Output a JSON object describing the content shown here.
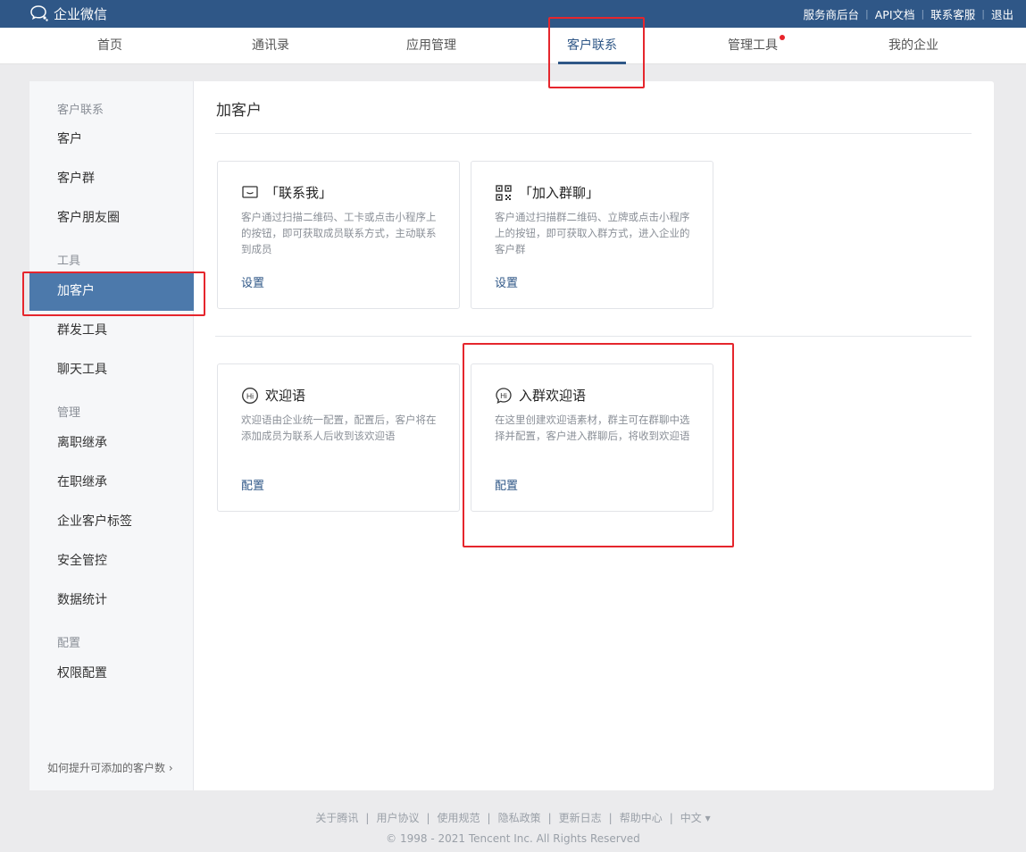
{
  "brand": {
    "name": "企业微信",
    "logo_icon": "wecom-logo-icon"
  },
  "top_links": [
    {
      "label": "服务商后台"
    },
    {
      "label": "API文档"
    },
    {
      "label": "联系客服"
    },
    {
      "label": "退出"
    }
  ],
  "nav": {
    "items": [
      {
        "label": "首页"
      },
      {
        "label": "通讯录"
      },
      {
        "label": "应用管理"
      },
      {
        "label": "客户联系",
        "active": true
      },
      {
        "label": "管理工具",
        "badge": "red-dot"
      },
      {
        "label": "我的企业"
      }
    ]
  },
  "sidebar": {
    "groups": [
      {
        "title": "客户联系",
        "items": [
          "客户",
          "客户群",
          "客户朋友圈"
        ]
      },
      {
        "title": "工具",
        "items": [
          "加客户",
          "群发工具",
          "聊天工具"
        ]
      },
      {
        "title": "管理",
        "items": [
          "离职继承",
          "在职继承",
          "企业客户标签",
          "安全管控",
          "数据统计"
        ]
      },
      {
        "title": "配置",
        "items": [
          "权限配置"
        ]
      }
    ],
    "active_item": "加客户",
    "footer_link": "如何提升可添加的客户数"
  },
  "main": {
    "title": "加客户",
    "cards": [
      {
        "icon": "contact-me-icon",
        "title": "「联系我」",
        "desc": "客户通过扫描二维码、工卡或点击小程序上的按钮，即可获取成员联系方式，主动联系到成员",
        "action": "设置"
      },
      {
        "icon": "qr-code-icon",
        "title": "「加入群聊」",
        "desc": "客户通过扫描群二维码、立牌或点击小程序上的按钮，即可获取入群方式，进入企业的客户群",
        "action": "设置"
      },
      {
        "icon": "hi-greeting-icon",
        "title": "欢迎语",
        "desc": "欢迎语由企业统一配置，配置后，客户将在添加成员为联系人后收到该欢迎语",
        "action": "配置"
      },
      {
        "icon": "hi-group-greeting-icon",
        "title": "入群欢迎语",
        "desc": "在这里创建欢迎语素材，群主可在群聊中选择并配置，客户进入群聊后，将收到欢迎语",
        "action": "配置"
      }
    ]
  },
  "footer": {
    "links": [
      "关于腾讯",
      "用户协议",
      "使用规范",
      "隐私政策",
      "更新日志",
      "帮助中心",
      "中文 ▾"
    ],
    "copyright": "© 1998 - 2021 Tencent Inc. All Rights Reserved"
  },
  "colors": {
    "topbar": "#2f5787",
    "accent": "#2f5787",
    "sidebar_active": "#4c79ab",
    "highlight": "#e5262d"
  }
}
